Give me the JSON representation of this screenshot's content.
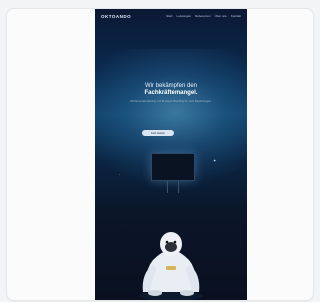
{
  "preview": {
    "logo": "OKTOANDO",
    "nav_links": [
      "Start",
      "Leistungen",
      "Referenzen",
      "Über uns",
      "Kontakt"
    ],
    "hero_line1": "Wir bekämpfen den",
    "hero_line2": "Fachkräftemangel.",
    "hero_subtitle": "Mit Personalmarketing und Employer Branding für mehr Bewerbungen.",
    "cta_label": "Jetzt starten",
    "illustration": "gorilla-in-white-suit",
    "colors": {
      "background_top": "#0b1833",
      "glow": "#6ebee6",
      "background_bottom": "#0a1020",
      "text": "#e8f2fb",
      "cta": "#d9e6f2"
    }
  }
}
